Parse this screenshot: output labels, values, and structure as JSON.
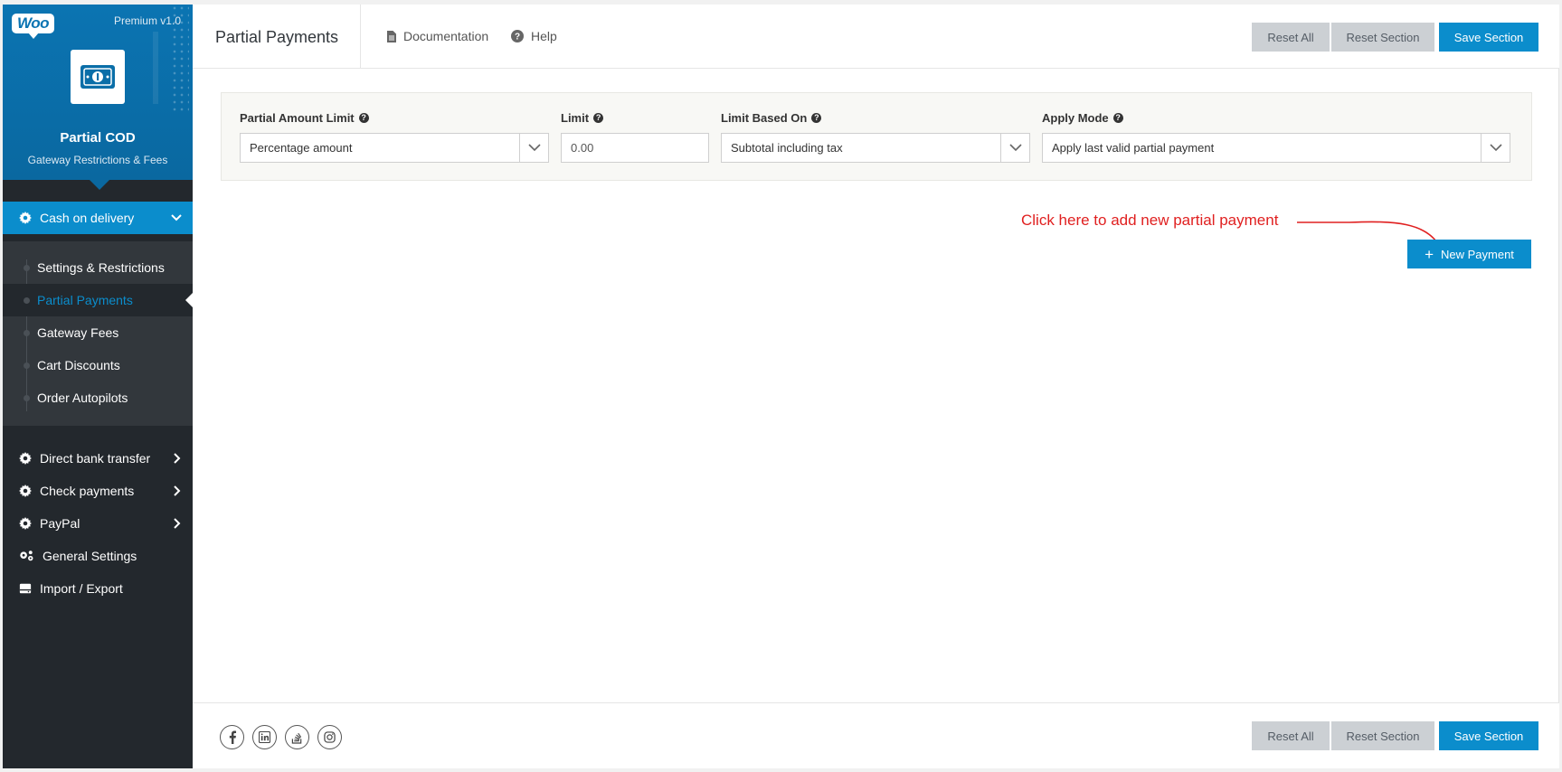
{
  "sidebar": {
    "brand": {
      "woo_logo": "Woo",
      "version": "Premium v1.0",
      "title": "Partial COD",
      "subtitle": "Gateway Restrictions & Fees"
    },
    "active_section": {
      "label": "Cash on delivery",
      "icon": "gear-icon"
    },
    "subitems": [
      {
        "label": "Settings & Restrictions"
      },
      {
        "label": "Partial Payments",
        "active": true
      },
      {
        "label": "Gateway Fees"
      },
      {
        "label": "Cart Discounts"
      },
      {
        "label": "Order Autopilots"
      }
    ],
    "items": [
      {
        "label": "Direct bank transfer",
        "icon": "gear-icon"
      },
      {
        "label": "Check payments",
        "icon": "gear-icon"
      },
      {
        "label": "PayPal",
        "icon": "gear-icon"
      },
      {
        "label": "General Settings",
        "icon": "gears-icon"
      },
      {
        "label": "Import / Export",
        "icon": "import-export-icon"
      }
    ]
  },
  "header": {
    "title": "Partial Payments",
    "documentation": "Documentation",
    "help": "Help",
    "reset_all": "Reset All",
    "reset_section": "Reset Section",
    "save_section": "Save Section"
  },
  "settings": {
    "partial_amount_limit": {
      "label": "Partial Amount Limit",
      "value": "Percentage amount"
    },
    "limit": {
      "label": "Limit",
      "value": "0.00"
    },
    "limit_based_on": {
      "label": "Limit Based On",
      "value": "Subtotal including tax"
    },
    "apply_mode": {
      "label": "Apply Mode",
      "value": "Apply last valid partial payment"
    }
  },
  "annotation": {
    "text": "Click here to add new partial payment",
    "color": "#e02020"
  },
  "new_payment": {
    "label": "New Payment"
  },
  "footer": {
    "social": [
      "facebook-icon",
      "linkedin-icon",
      "stackoverflow-icon",
      "instagram-icon"
    ],
    "reset_all": "Reset All",
    "reset_section": "Reset Section",
    "save_section": "Save Section"
  },
  "colors": {
    "accent": "#0b8dcc",
    "sidebar_bg": "#23282d",
    "brand_bg": "#0a6ea8"
  }
}
